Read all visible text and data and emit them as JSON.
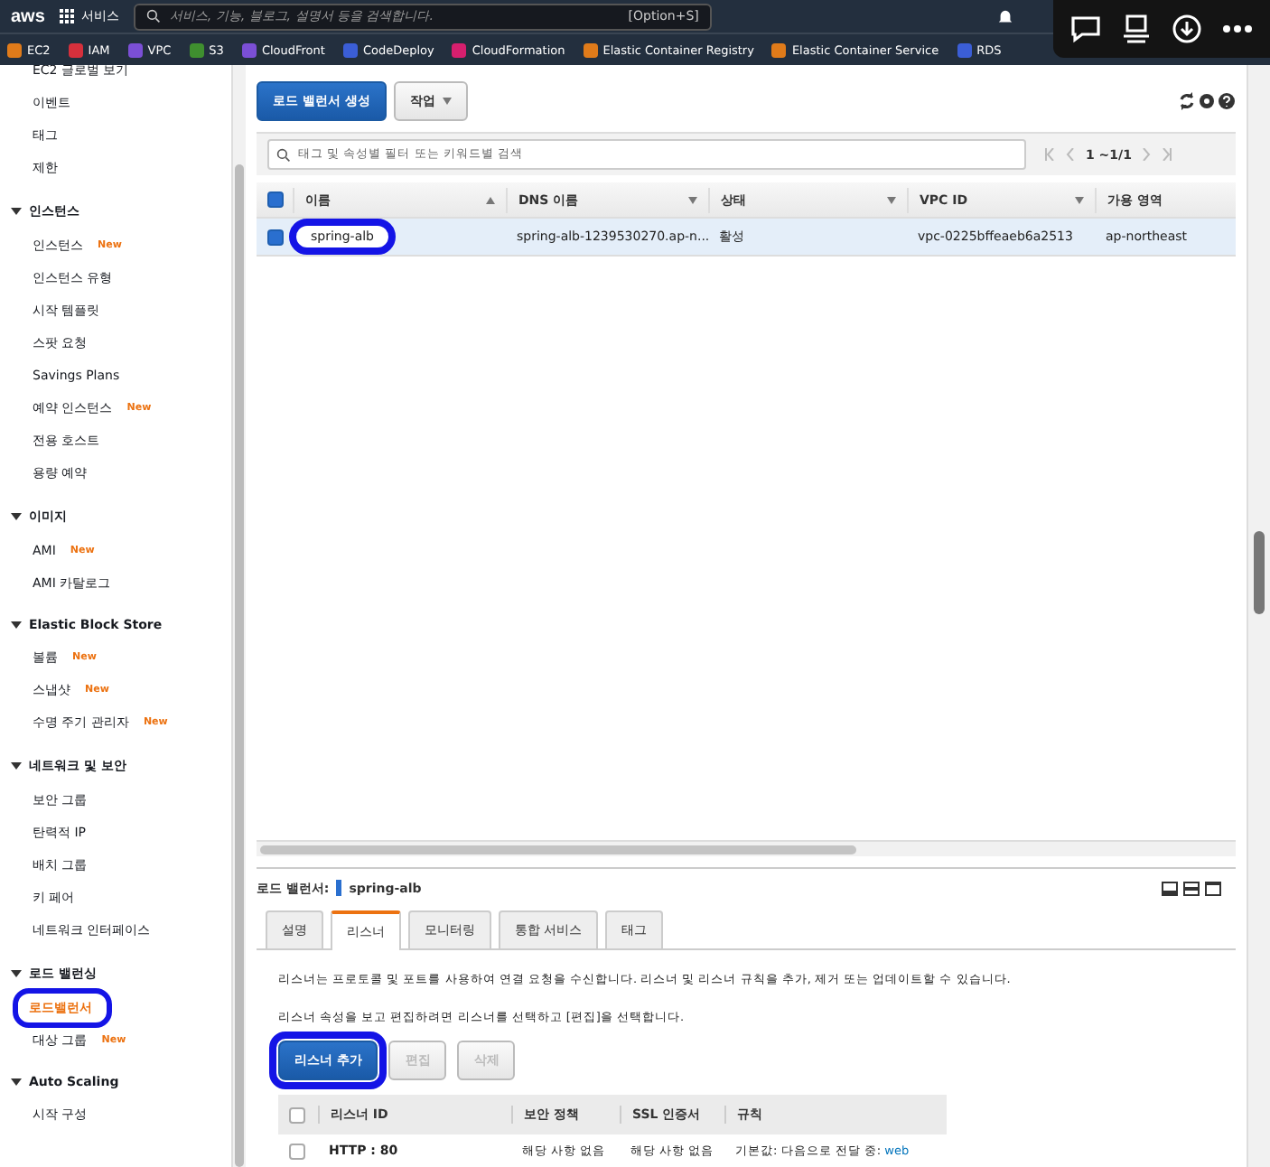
{
  "top_nav": {
    "logo": "aws",
    "services": "서비스",
    "search_placeholder": "서비스, 기능, 블로그, 설명서 등을 검색합니다.",
    "shortcut": "[Option+S]"
  },
  "bookmarks": [
    {
      "label": "EC2",
      "color": "#e07b1a"
    },
    {
      "label": "IAM",
      "color": "#d6303c"
    },
    {
      "label": "VPC",
      "color": "#7b4fd6"
    },
    {
      "label": "S3",
      "color": "#3f8f2f"
    },
    {
      "label": "CloudFront",
      "color": "#7b4fd6"
    },
    {
      "label": "CodeDeploy",
      "color": "#3b5ed6"
    },
    {
      "label": "CloudFormation",
      "color": "#d61f6e"
    },
    {
      "label": "Elastic Container Registry",
      "color": "#e07b1a"
    },
    {
      "label": "Elastic Container Service",
      "color": "#e07b1a"
    },
    {
      "label": "RDS",
      "color": "#3b5ed6"
    }
  ],
  "sidebar": {
    "sections": [
      {
        "items": [
          {
            "label": "EC2 글로벌 보기",
            "selected": false,
            "highlighted": false
          },
          {
            "label": "이벤트",
            "selected": false,
            "highlighted": false
          },
          {
            "label": "태그",
            "selected": false,
            "highlighted": false
          },
          {
            "label": "제한",
            "selected": false,
            "highlighted": false
          }
        ]
      },
      {
        "title": "인스턴스",
        "items": [
          {
            "label": "인스턴스",
            "badge": "New",
            "selected": false,
            "highlighted": false
          },
          {
            "label": "인스턴스 유형",
            "selected": false,
            "highlighted": false
          },
          {
            "label": "시작 템플릿",
            "selected": false,
            "highlighted": false
          },
          {
            "label": "스팟 요청",
            "selected": false,
            "highlighted": false
          },
          {
            "label": "Savings Plans",
            "selected": false,
            "highlighted": false
          },
          {
            "label": "예약 인스턴스",
            "badge": "New",
            "selected": false,
            "highlighted": false
          },
          {
            "label": "전용 호스트",
            "selected": false,
            "highlighted": false
          },
          {
            "label": "용량 예약",
            "selected": false,
            "highlighted": false
          }
        ]
      },
      {
        "title": "이미지",
        "items": [
          {
            "label": "AMI",
            "badge": "New",
            "selected": false,
            "highlighted": false
          },
          {
            "label": "AMI 카탈로그",
            "selected": false,
            "highlighted": false
          }
        ]
      },
      {
        "title": "Elastic Block Store",
        "items": [
          {
            "label": "볼륨",
            "badge": "New",
            "selected": false,
            "highlighted": false
          },
          {
            "label": "스냅샷",
            "badge": "New",
            "selected": false,
            "highlighted": false
          },
          {
            "label": "수명 주기 관리자",
            "badge": "New",
            "selected": false,
            "highlighted": false
          }
        ]
      },
      {
        "title": "네트워크 및 보안",
        "items": [
          {
            "label": "보안 그룹",
            "selected": false,
            "highlighted": false
          },
          {
            "label": "탄력적 IP",
            "selected": false,
            "highlighted": false
          },
          {
            "label": "배치 그룹",
            "selected": false,
            "highlighted": false
          },
          {
            "label": "키 페어",
            "selected": false,
            "highlighted": false
          },
          {
            "label": "네트워크 인터페이스",
            "selected": false,
            "highlighted": false
          }
        ]
      },
      {
        "title": "로드 밸런싱",
        "items": [
          {
            "label": "로드밸런서",
            "selected": true,
            "highlighted": true
          },
          {
            "label": "대상 그룹",
            "badge": "New",
            "selected": false,
            "highlighted": false
          }
        ]
      },
      {
        "title": "Auto Scaling",
        "items": [
          {
            "label": "시작 구성",
            "selected": false,
            "highlighted": false
          }
        ]
      }
    ]
  },
  "toolbar": {
    "create_button": "로드 밸런서 생성",
    "actions_button": "작업"
  },
  "filter": {
    "placeholder": "태그 및 속성별 필터 또는 키워드별 검색",
    "pagination": "1 ~1/1"
  },
  "table": {
    "all_checked": true,
    "columns": [
      "이름",
      "DNS 이름",
      "상태",
      "VPC ID",
      "가용 영역"
    ],
    "rows": [
      {
        "selected": true,
        "highlighted": true,
        "cells": [
          "spring-alb",
          "spring-alb-1239530270.ap-n...",
          "활성",
          "vpc-0225bffeaeb6a2513",
          "ap-northeast"
        ]
      }
    ]
  },
  "details": {
    "label": "로드 밸런서:",
    "name": "spring-alb",
    "tabs": [
      {
        "label": "설명",
        "selected": false
      },
      {
        "label": "리스너",
        "selected": true
      },
      {
        "label": "모니터링",
        "selected": false
      },
      {
        "label": "통합 서비스",
        "selected": false
      },
      {
        "label": "태그",
        "selected": false
      }
    ],
    "texts": [
      "리스너는 프로토콜 및 포트를 사용하여 연결 요청을 수신합니다. 리스너 및 리스너 규칙을 추가, 제거 또는 업데이트할 수 있습니다.",
      "리스너 속성을 보고 편집하려면 리스너를 선택하고 [편집]을 선택합니다."
    ],
    "buttons": [
      {
        "label": "리스너 추가",
        "disabled": false,
        "highlighted": true
      },
      {
        "label": "편집",
        "disabled": true,
        "highlighted": false
      },
      {
        "label": "삭제",
        "disabled": true,
        "highlighted": false
      }
    ],
    "listener_table": {
      "all_checked": false,
      "columns": [
        "리스너 ID",
        "보안 정책",
        "SSL 인증서",
        "규칙"
      ],
      "rows": [
        {
          "checked": false,
          "id": "HTTP : 80",
          "policy": "해당 사항 없음",
          "cert": "해당 사항 없음",
          "rule_prefix": "기본값:  다음으로 전달 중:",
          "rule_link": "web"
        }
      ]
    }
  }
}
